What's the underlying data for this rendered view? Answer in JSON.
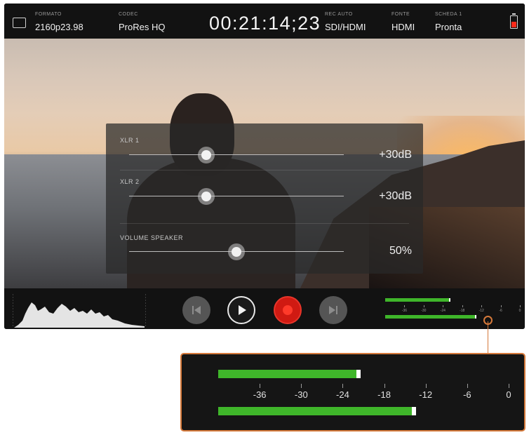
{
  "top_bar": {
    "format": {
      "label": "FORMATO",
      "value": "2160p23.98"
    },
    "codec": {
      "label": "CODEC",
      "value": "ProRes HQ"
    },
    "timecode": "00:21:14;23",
    "rec_source": {
      "label": "REC AUTO",
      "value": "SDI/HDMI"
    },
    "input": {
      "label": "FONTE",
      "value": "HDMI"
    },
    "card": {
      "label": "SCHEDA 1",
      "value": "Pronta"
    },
    "battery": {
      "level": 0.55,
      "color": "#ff2a1a"
    }
  },
  "audio_panel": {
    "channels": [
      {
        "label": "XLR 1",
        "value": "+30dB",
        "slider_fraction": 0.36
      },
      {
        "label": "XLR 2",
        "value": "+30dB",
        "slider_fraction": 0.36
      },
      {
        "label": "VOLUME SPEAKER",
        "value": "50%",
        "slider_fraction": 0.5
      }
    ]
  },
  "transport": {
    "buttons": [
      {
        "name": "skip-back-button",
        "icon": "skip-back-icon"
      },
      {
        "name": "play-button",
        "icon": "play-icon"
      },
      {
        "name": "record-button",
        "icon": "record-icon"
      },
      {
        "name": "skip-forward-button",
        "icon": "skip-forward-icon"
      }
    ]
  },
  "audio_meters": {
    "scale": [
      "-36",
      "-30",
      "-24",
      "-18",
      "-12",
      "-6",
      "0"
    ],
    "channel_1_level_db": -22,
    "channel_2_level_db": -14,
    "meter_color": "#3fb62a"
  },
  "colors": {
    "accent_callout": "#d5793b",
    "record": "#d01a12"
  }
}
